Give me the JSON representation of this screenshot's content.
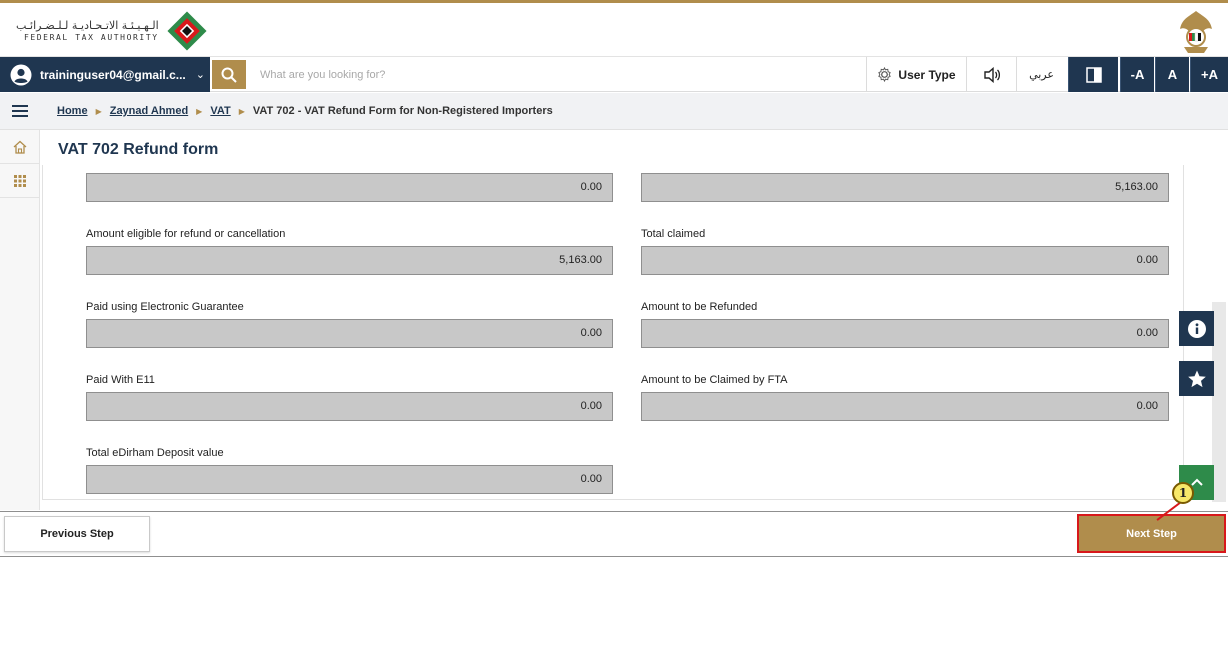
{
  "header": {
    "logo_arabic": "الـهـيـئـة الاتـحـاديـة لـلـضـرائـب",
    "logo_english": "FEDERAL TAX AUTHORITY"
  },
  "navbar": {
    "user_email": "traininguser04@gmail.c...",
    "search_placeholder": "What are you looking for?",
    "user_type_label": "User Type",
    "arabic_label": "عربي",
    "font_decrease": "-A",
    "font_normal": "A",
    "font_increase": "+A"
  },
  "breadcrumb": {
    "items": [
      "Home",
      "Zaynad Ahmed",
      "VAT"
    ],
    "current": "VAT 702 - VAT Refund Form for Non-Registered Importers"
  },
  "page": {
    "title": "VAT 702 Refund form"
  },
  "form": {
    "top_left_value": "0.00",
    "top_right_value": "5,163.00",
    "fields": [
      {
        "label": "Amount eligible for refund or cancellation",
        "value": "5,163.00"
      },
      {
        "label": "Total claimed",
        "value": "0.00"
      },
      {
        "label": "Paid using Electronic Guarantee",
        "value": "0.00"
      },
      {
        "label": "Amount to be Refunded",
        "value": "0.00"
      },
      {
        "label": "Paid With E11",
        "value": "0.00"
      },
      {
        "label": "Amount to be Claimed by FTA",
        "value": "0.00"
      },
      {
        "label": "Total eDirham Deposit value",
        "value": "0.00"
      }
    ]
  },
  "footer": {
    "previous_label": "Previous Step",
    "next_label": "Next Step"
  },
  "annotation": {
    "badge": "1"
  },
  "colors": {
    "navy": "#1f3650",
    "gold": "#b08d4c",
    "highlight_red": "#d8181b",
    "field_bg": "#c8c8c8"
  }
}
